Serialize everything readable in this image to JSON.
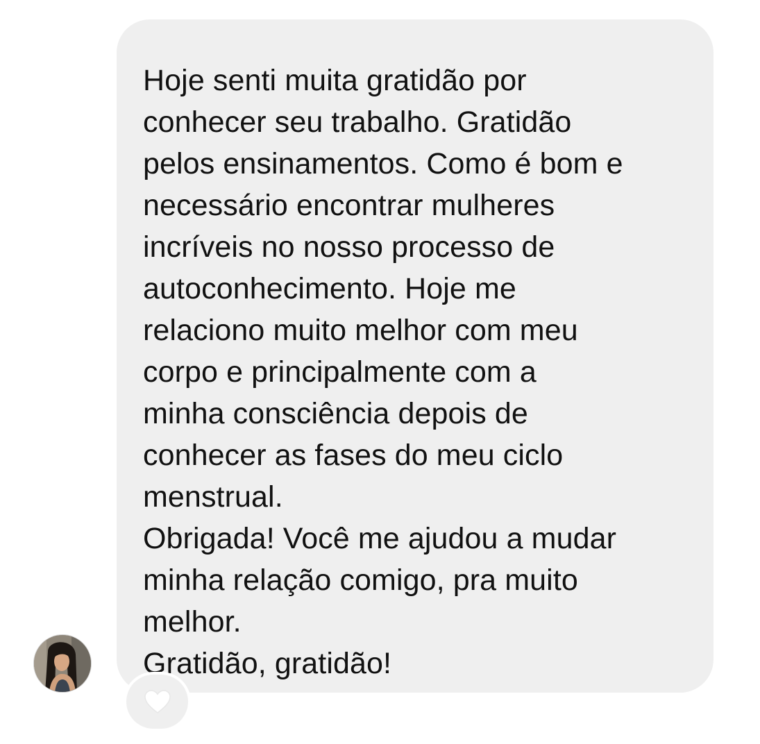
{
  "message": {
    "paragraphs": [
      {
        "lines": [
          "Hoje senti muita gratidão por",
          "conhecer seu trabalho. Gratidão",
          "pelos ensinamentos. Como é bom e",
          "necessário encontrar mulheres",
          "incríveis no nosso processo de",
          "autoconhecimento. Hoje me",
          "relaciono muito melhor com meu",
          "corpo e principalmente com a",
          "minha consciência depois de",
          "conhecer as fases do meu ciclo",
          "menstrual."
        ]
      },
      {
        "lines": [
          "Obrigada! Você me ajudou a mudar",
          "minha relação comigo, pra muito",
          "melhor."
        ]
      },
      {
        "lines": [
          "Gratidão, gratidão!"
        ]
      }
    ]
  },
  "reaction": {
    "icon": "heart-icon",
    "color": "#ffffff"
  },
  "avatar": {
    "icon": "profile-photo"
  },
  "colors": {
    "bubble": "#efefef",
    "text": "#111111",
    "background": "#ffffff"
  }
}
